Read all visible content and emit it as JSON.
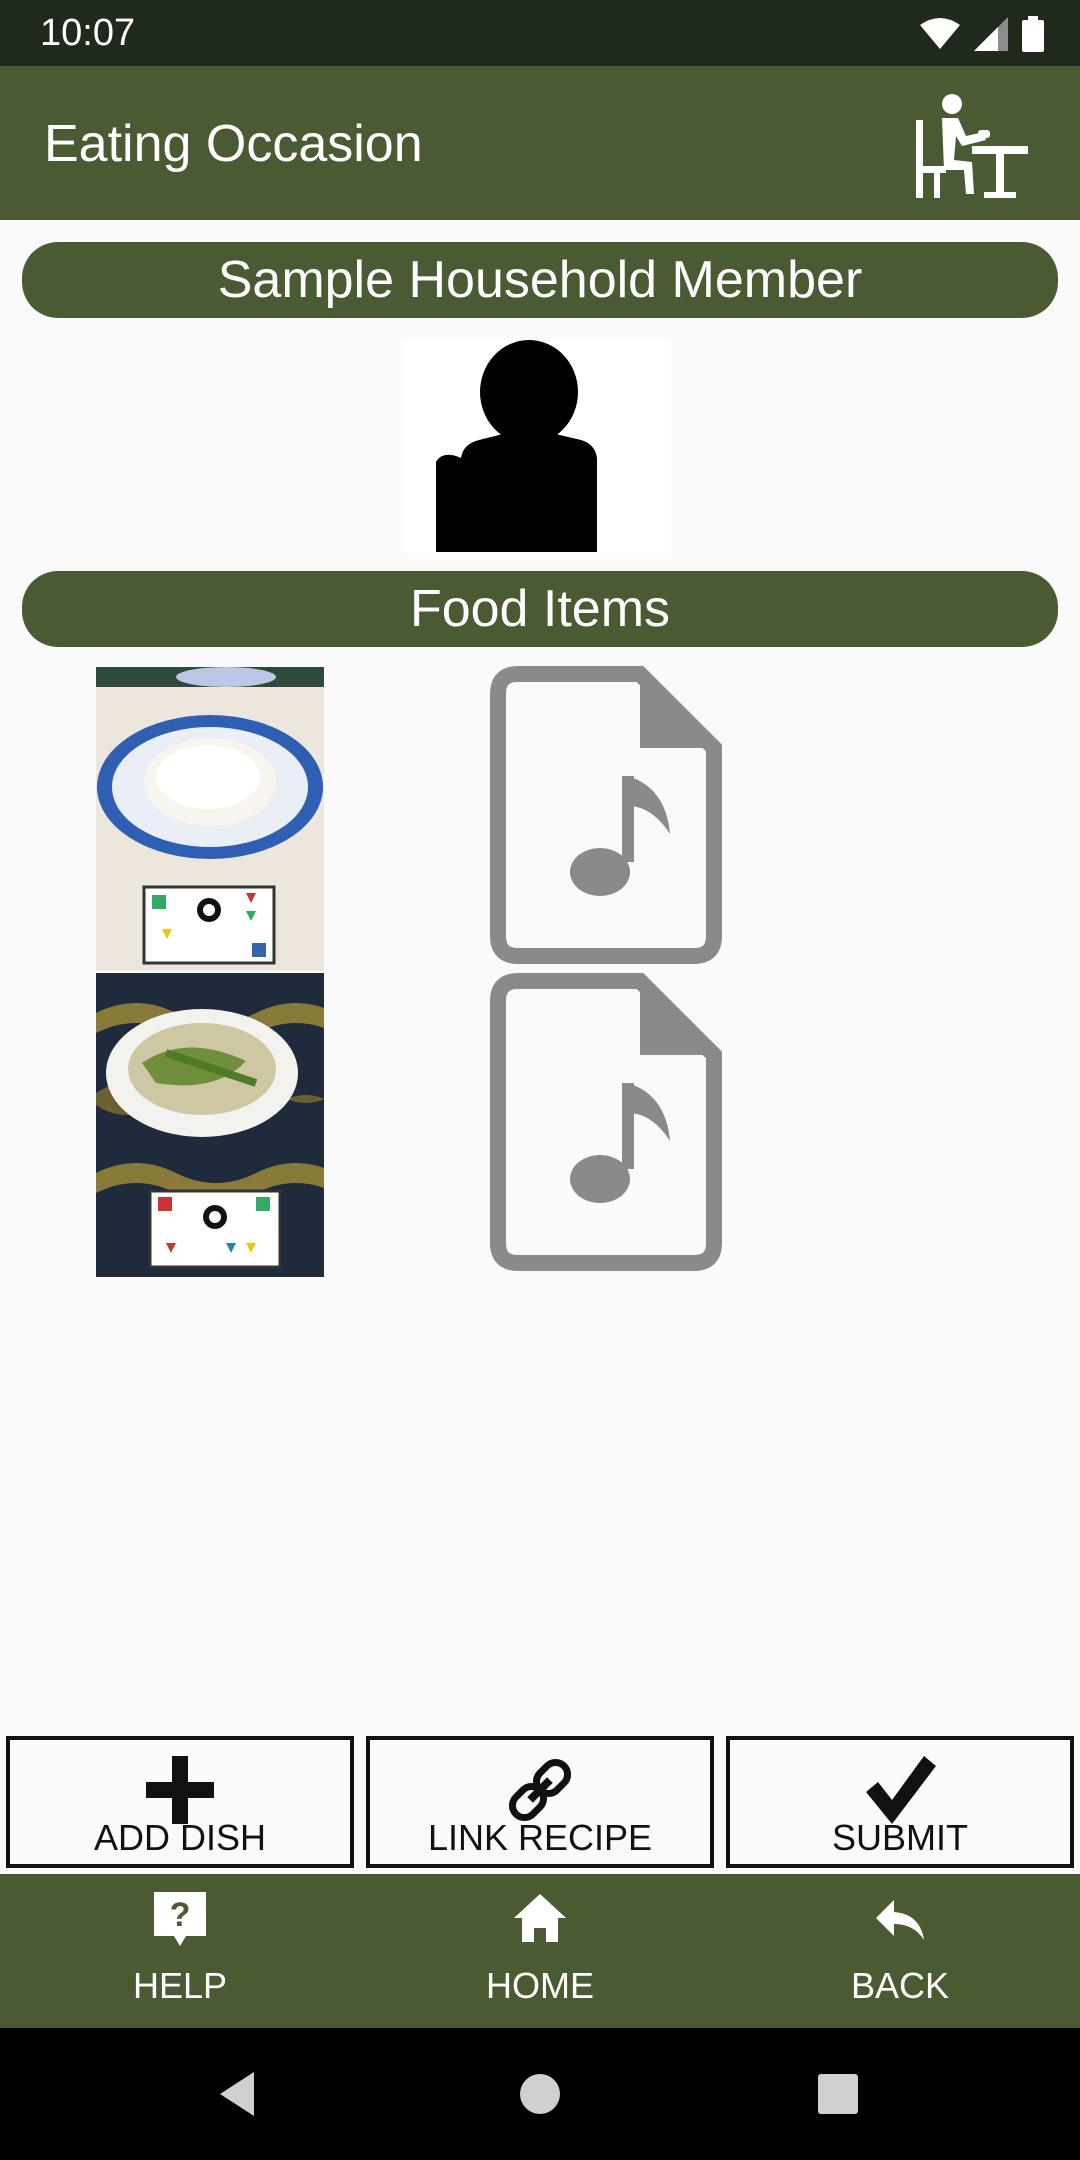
{
  "status_bar": {
    "time": "10:07"
  },
  "app_bar": {
    "title": "Eating Occasion",
    "icon": "dining-person-icon"
  },
  "member_section": {
    "title": "Sample Household Member",
    "avatar": "person-silhouette-icon"
  },
  "food_section": {
    "title": "Food Items",
    "items": [
      {
        "photo": "plate-of-rice-photo",
        "audio_icon": "audio-file-icon"
      },
      {
        "photo": "bowl-of-noodle-soup-photo",
        "audio_icon": "audio-file-icon"
      }
    ]
  },
  "actions": {
    "add_dish": {
      "label": "ADD DISH",
      "icon": "plus-icon"
    },
    "link_recipe": {
      "label": "LINK RECIPE",
      "icon": "link-icon"
    },
    "submit": {
      "label": "SUBMIT",
      "icon": "checkmark-icon"
    }
  },
  "bottom_nav": {
    "help": {
      "label": "HELP",
      "icon": "help-icon"
    },
    "home": {
      "label": "HOME",
      "icon": "home-icon"
    },
    "back": {
      "label": "BACK",
      "icon": "reply-arrow-icon"
    }
  },
  "colors": {
    "primary": "#4a5a33",
    "status_bar": "#1f2a1c",
    "background": "#fafafa",
    "audio_icon": "#8a8a8a"
  }
}
